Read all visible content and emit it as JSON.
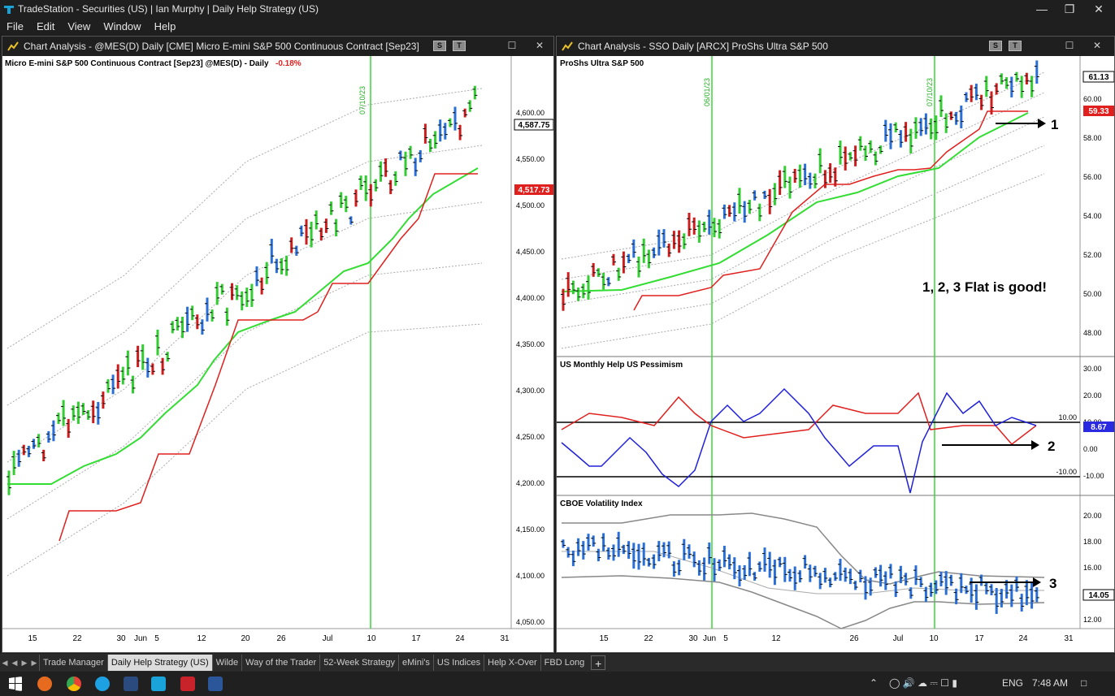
{
  "window": {
    "app": "TradeStation",
    "title": "Securities (US)",
    "user": "Ian Murphy",
    "workspace": "Daily Help Strategy (US)"
  },
  "menu": [
    "File",
    "Edit",
    "View",
    "Window",
    "Help"
  ],
  "left_chart": {
    "window_title": "Chart Analysis - @MES(D) Daily [CME] Micro E-mini S&P 500 Continuous Contract [Sep23]",
    "btn_s": "S",
    "btn_t": "T",
    "legend_name": "Micro E-mini S&P 500 Continuous Contract [Sep23]  @MES(D) - Daily",
    "legend_change": "-0.18%",
    "marker_label": "07/10/23",
    "price_badge": "4,587.75",
    "stop_badge": "4,517.73",
    "y_ticks": [
      "4,600.00",
      "4,550.00",
      "4,500.00",
      "4,450.00",
      "4,400.00",
      "4,350.00",
      "4,300.00",
      "4,250.00",
      "4,200.00",
      "4,150.00",
      "4,100.00",
      "4,050.00"
    ],
    "x_ticks": [
      "15",
      "22",
      "30",
      "Jun",
      "5",
      "12",
      "20",
      "26",
      "Jul",
      "10",
      "17",
      "24",
      "31"
    ]
  },
  "right_chart": {
    "window_title": "Chart Analysis - SSO Daily [ARCX] ProShs Ultra S&P 500",
    "btn_s": "S",
    "btn_t": "T",
    "legend_name": "ProShs Ultra S&P 500",
    "marker_1": "06/01/23",
    "marker_2": "07/10/23",
    "price_badge": "61.13",
    "stop_badge": "59.33",
    "annotation_1": "1",
    "annotation_2": "2",
    "annotation_3": "3",
    "note": "1, 2, 3 Flat is good!",
    "y_ticks": [
      "60.00",
      "58.00",
      "56.00",
      "54.00",
      "52.00",
      "50.00",
      "48.00"
    ],
    "sub1": {
      "title": "US Monthly Help  US Pessimism",
      "level_hi": "10.00",
      "level_lo": "-10.00",
      "badge": "8.67",
      "y_ticks": [
        "30.00",
        "20.00",
        "10.00",
        "0.00",
        "-10.00"
      ]
    },
    "sub2": {
      "title": "CBOE Volatility Index",
      "badge": "14.05",
      "y_ticks": [
        "20.00",
        "18.00",
        "16.00",
        "14.00",
        "12.00"
      ]
    },
    "x_ticks": [
      "15",
      "22",
      "30",
      "Jun",
      "5",
      "12",
      "26",
      "Jul",
      "10",
      "17",
      "24",
      "31"
    ]
  },
  "tabs": [
    "Trade Manager",
    "Daily Help Strategy (US)",
    "Wilde",
    "Way of the Trader",
    "52-Week Strategy",
    "eMini's",
    "US Indices",
    "Help X-Over",
    "FBD Long"
  ],
  "taskbar": {
    "lang": "ENG",
    "time": "7:48 AM"
  }
}
